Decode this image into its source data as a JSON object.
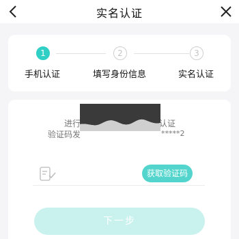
{
  "header": {
    "title": "实名认证",
    "back_icon": "chevron-left-icon",
    "close_icon": "close-icon"
  },
  "steps": [
    {
      "number": "1",
      "label": "手机认证",
      "state": "active"
    },
    {
      "number": "2",
      "label": "填写身份信息",
      "state": "pending"
    },
    {
      "number": "3",
      "label": "实名认证",
      "state": "pending"
    }
  ],
  "verification": {
    "line1_left": "进行",
    "line1_right": "认证",
    "line2_left": "验证码发",
    "line2_right": "*****2",
    "code_icon": "verification-code-icon",
    "get_code_label": "获取验证码"
  },
  "next_label": "下一步",
  "colors": {
    "accent": "#2fcfc6",
    "button": "#53d5cd",
    "next_disabled": "#c9f2ef"
  }
}
